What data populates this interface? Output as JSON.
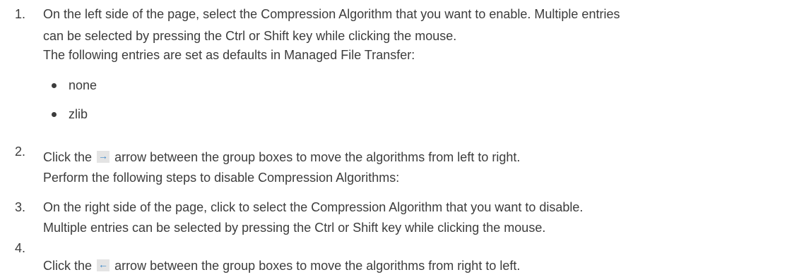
{
  "steps": [
    {
      "number": "1.",
      "lines": [
        "On the left side of the page, select the Compression Algorithm that you want to enable. Multiple entries",
        "can be selected by pressing the Ctrl or Shift key while clicking the mouse.",
        "The following entries are set as defaults in Managed File Transfer:"
      ],
      "bullets": [
        "none",
        "zlib"
      ]
    },
    {
      "number": "2.",
      "line1_before": "Click the",
      "arrow_icon": "arrow-right-icon",
      "arrow_glyph": "→",
      "line1_after": "arrow between the group boxes to move the algorithms from left to right.",
      "line2": "Perform the following steps to disable Compression Algorithms:"
    },
    {
      "number": "3.",
      "lines": [
        "On the right side of the page, click to select the Compression Algorithm that you want to disable.",
        "Multiple entries can be selected by pressing the Ctrl or Shift key while clicking the mouse."
      ]
    },
    {
      "number": "4.",
      "line1_before": "Click the",
      "arrow_icon": "arrow-left-icon",
      "arrow_glyph": "←",
      "line1_after": "arrow between the group boxes to move the algorithms from right to left."
    }
  ],
  "colors": {
    "text": "#3c3c3c",
    "arrow": "#3b86c9",
    "arrow_bg": "#e4e4e4"
  }
}
